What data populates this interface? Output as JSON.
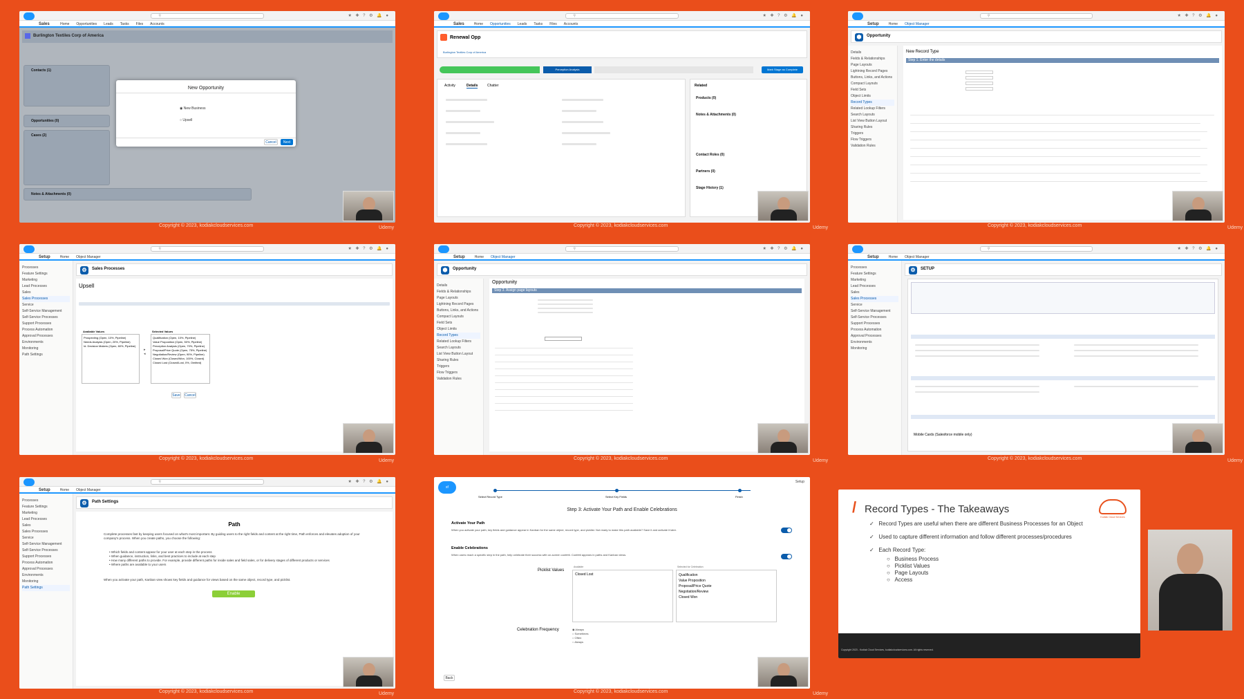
{
  "captions": {
    "copyright": "Copyright © 2023, kodiakcloudservices.com",
    "brand": "Udemy"
  },
  "tile1": {
    "app": "Sales",
    "record_title": "Burlington Textiles Corp of America",
    "modal_title": "New Opportunity",
    "option_1": "New Business",
    "option_2": "Upsell",
    "cancel": "Cancel",
    "next": "Next",
    "contacts": "Contacts (1)",
    "opportunities": "Opportunities (0)",
    "cases": "Cases (2)",
    "notes": "Notes & Attachments (0)"
  },
  "tile2": {
    "record_title": "Renewal Opp",
    "account": "Burlington Textiles Corp of America",
    "stage_current": "Perception Analysis",
    "mark_btn": "Mark Stage as Complete",
    "tabs": [
      "Activity",
      "Details",
      "Chatter"
    ],
    "related": "Related",
    "products": "Products (0)",
    "notes": "Notes & Attachments (0)",
    "contact_roles": "Contact Roles (0)",
    "partners": "Partners (0)",
    "stage_history": "Stage History (1)"
  },
  "tile3": {
    "setup": "Setup",
    "object_manager": "Object Manager",
    "object": "Opportunity",
    "header": "New Record Type",
    "step": "Step 1. Enter the details",
    "sidebar": [
      "Details",
      "Fields & Relationships",
      "Page Layouts",
      "Lightning Record Pages",
      "Buttons, Links, and Actions",
      "Compact Layouts",
      "Field Sets",
      "Object Limits",
      "Record Types",
      "Related Lookup Filters",
      "Search Layouts",
      "List View Button Layout",
      "Sharing Rules",
      "Triggers",
      "Flow Triggers",
      "Validation Rules"
    ]
  },
  "tile4": {
    "title": "Sales Processes",
    "name": "Upsell",
    "sidebar": [
      "Processes",
      "Feature Settings",
      "Marketing",
      "Lead Processes",
      "Sales",
      "Sales Processes",
      "Service",
      "Self-Service Management",
      "Self-Service Processes",
      "Support Processes",
      "Process Automation",
      "Approval Processes",
      "Environments",
      "Monitoring",
      "Path Settings"
    ],
    "available_label": "Available Values",
    "selected_label": "Selected Values",
    "available": [
      "Prospecting (Open, 10%, Pipeline)",
      "Needs Analysis (Open, 20%, Pipeline)",
      "Id. Decision Makers (Open, 60%, Pipeline)"
    ],
    "selected": [
      "Qualification (Open, 10%, Pipeline)",
      "Value Proposition (Open, 50%, Pipeline)",
      "Perception Analysis (Open, 70%, Pipeline)",
      "Proposal/Price Quote (Open, 75%, Pipeline)",
      "Negotiation/Review (Open, 90%, Pipeline)",
      "Closed Won (Closed/Won, 100%, Closed)",
      "Closed Lost (Closed/Lost, 0%, Omitted)"
    ],
    "save": "Save",
    "cancel": "Cancel"
  },
  "tile5": {
    "object": "Opportunity",
    "step": "Step 3. Assign page layouts",
    "heading": "Opportunity"
  },
  "tile6": {
    "setup": "SETUP",
    "mobile_cards": "Mobile Cards (Salesforce mobile only)"
  },
  "tile7": {
    "title": "Path Settings",
    "heading": "Path",
    "intro": "Complete processes fast by keeping users focused on what's most important. By guiding users to the right fields and content at the right time, Path enforces and elevates adoption of your company's process. When you create paths, you choose the following:",
    "bullets": [
      "Which fields and content appear for your user at each step in the process",
      "When guidance, instruction, links, and best practices to include at each step",
      "How many different paths to provide. For example, provide different paths for inside sales and field sales, or for delivery stages of different products or services",
      "Where paths are available to your users"
    ],
    "note": "When you activate your path, Kanban view shows key fields and guidance for views based on the same object, record type, and picklist.",
    "enable": "Enable"
  },
  "tile8": {
    "steps": [
      "Select Record Type",
      "Select Key Fields",
      "Finish"
    ],
    "title": "Step 3: Activate Your Path and Enable Celebrations",
    "activate_heading": "Activate Your Path",
    "activate_text": "When you activate your path, key fields and guidance appear in Kanban for the same object, record type, and picklist. Not ready to make this path available? Save it and activate it later.",
    "celebrations_heading": "Enable Celebrations",
    "celebrations_text": "When users reach a specific step in the path, help celebrate their success with on-screen confetti. Confetti appears in paths and Kanban views.",
    "picklist_label": "Picklist Values",
    "available_header": "Available",
    "selected_header": "Selected for Celebration",
    "available": [
      "Closed Lost"
    ],
    "selected": [
      "Qualification",
      "Value Proposition",
      "Proposal/Price Quote",
      "Negotiation/Review",
      "Closed Won"
    ],
    "frequency_label": "Celebration Frequency",
    "frequency_options": [
      "Always",
      "Sometimes",
      "Often",
      "Always"
    ],
    "back": "Back",
    "setup": "Setup"
  },
  "tile9": {
    "title": "Record Types - The Takeaways",
    "bullets": [
      "Record Types are useful when there are different Business Processes for an Object",
      "Used to capture different information and follow different processes/procedures",
      "Each Record Type:"
    ],
    "sub_items": [
      "Business Process",
      "Picklist Values",
      "Page Layouts",
      "Access"
    ],
    "footer": "Copyright 2023 - Kodiak Cloud Services, kodiakcloudservices.com. All rights reserved.",
    "logo_text": "Kodiak Cloud Services"
  },
  "colors": {
    "background": "#ea4e1b",
    "salesforce_blue": "#1b96ff",
    "setup_blue": "#0b5cab",
    "path_green": "#45c65a",
    "enable_green": "#8ccf38",
    "slide_accent": "#e8511d"
  }
}
